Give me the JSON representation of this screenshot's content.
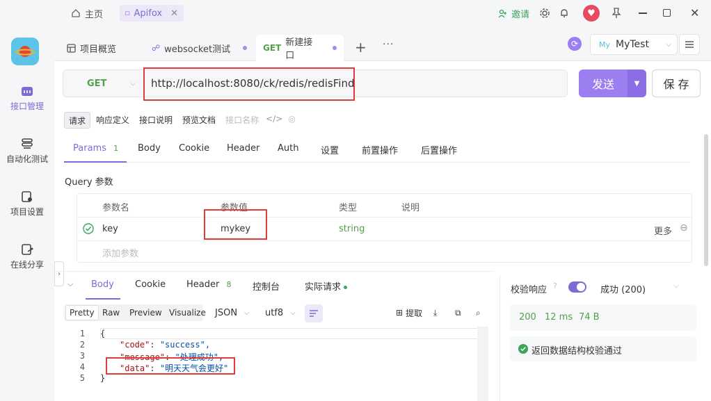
{
  "titlebar": {
    "home_label": "主页",
    "app_tab_label": "Apifox",
    "invite_label": "邀请"
  },
  "sidebar": {
    "items": [
      {
        "label": "接口管理"
      },
      {
        "label": "自动化测试"
      },
      {
        "label": "项目设置"
      },
      {
        "label": "在线分享"
      }
    ]
  },
  "doc_tabs": [
    {
      "label": "项目概览"
    },
    {
      "label": "websocket测试"
    },
    {
      "method": "GET",
      "label": "新建接口"
    }
  ],
  "env": {
    "prefix": "My",
    "name": "MyTest"
  },
  "request": {
    "method": "GET",
    "url": "http://localhost:8080/ck/redis/redisFind",
    "send_label": "发送",
    "save_label": "保 存"
  },
  "subtabs": [
    "请求",
    "响应定义",
    "接口说明",
    "预览文档"
  ],
  "name_placeholder": "接口名称",
  "req_tabs": {
    "params": "Params",
    "params_count": "1",
    "items": [
      "Body",
      "Cookie",
      "Header",
      "Auth",
      "设置",
      "前置操作",
      "后置操作"
    ]
  },
  "query": {
    "title": "Query 参数",
    "headers": [
      "参数名",
      "参数值",
      "类型",
      "说明"
    ],
    "row": {
      "name": "key",
      "value": "mykey",
      "type": "string",
      "more": "更多"
    },
    "add_placeholder": "添加参数"
  },
  "response": {
    "tabs": {
      "body": "Body",
      "cookie": "Cookie",
      "header": "Header",
      "header_count": "8",
      "console": "控制台",
      "actual": "实际请求"
    },
    "formats": [
      "Pretty",
      "Raw",
      "Preview",
      "Visualize"
    ],
    "lang": "JSON",
    "encoding": "utf8",
    "extract": "提取",
    "code_lines": [
      {
        "n": "1",
        "text": "{"
      },
      {
        "n": "2",
        "key": "\"code\"",
        "val": "\"success\","
      },
      {
        "n": "3",
        "key": "\"message\"",
        "val": "\"处理成功\","
      },
      {
        "n": "4",
        "key": "\"data\"",
        "val": "\"明天天气会更好\""
      },
      {
        "n": "5",
        "text": "}"
      }
    ]
  },
  "validation": {
    "label": "校验响应",
    "result": "成功 (200)",
    "status": "200",
    "time": "12 ms",
    "size": "74 B",
    "message": "返回数据结构校验通过"
  },
  "colors": {
    "accent": "#7c6bd6",
    "green": "#52a04a",
    "red_box": "#e03b3b"
  }
}
